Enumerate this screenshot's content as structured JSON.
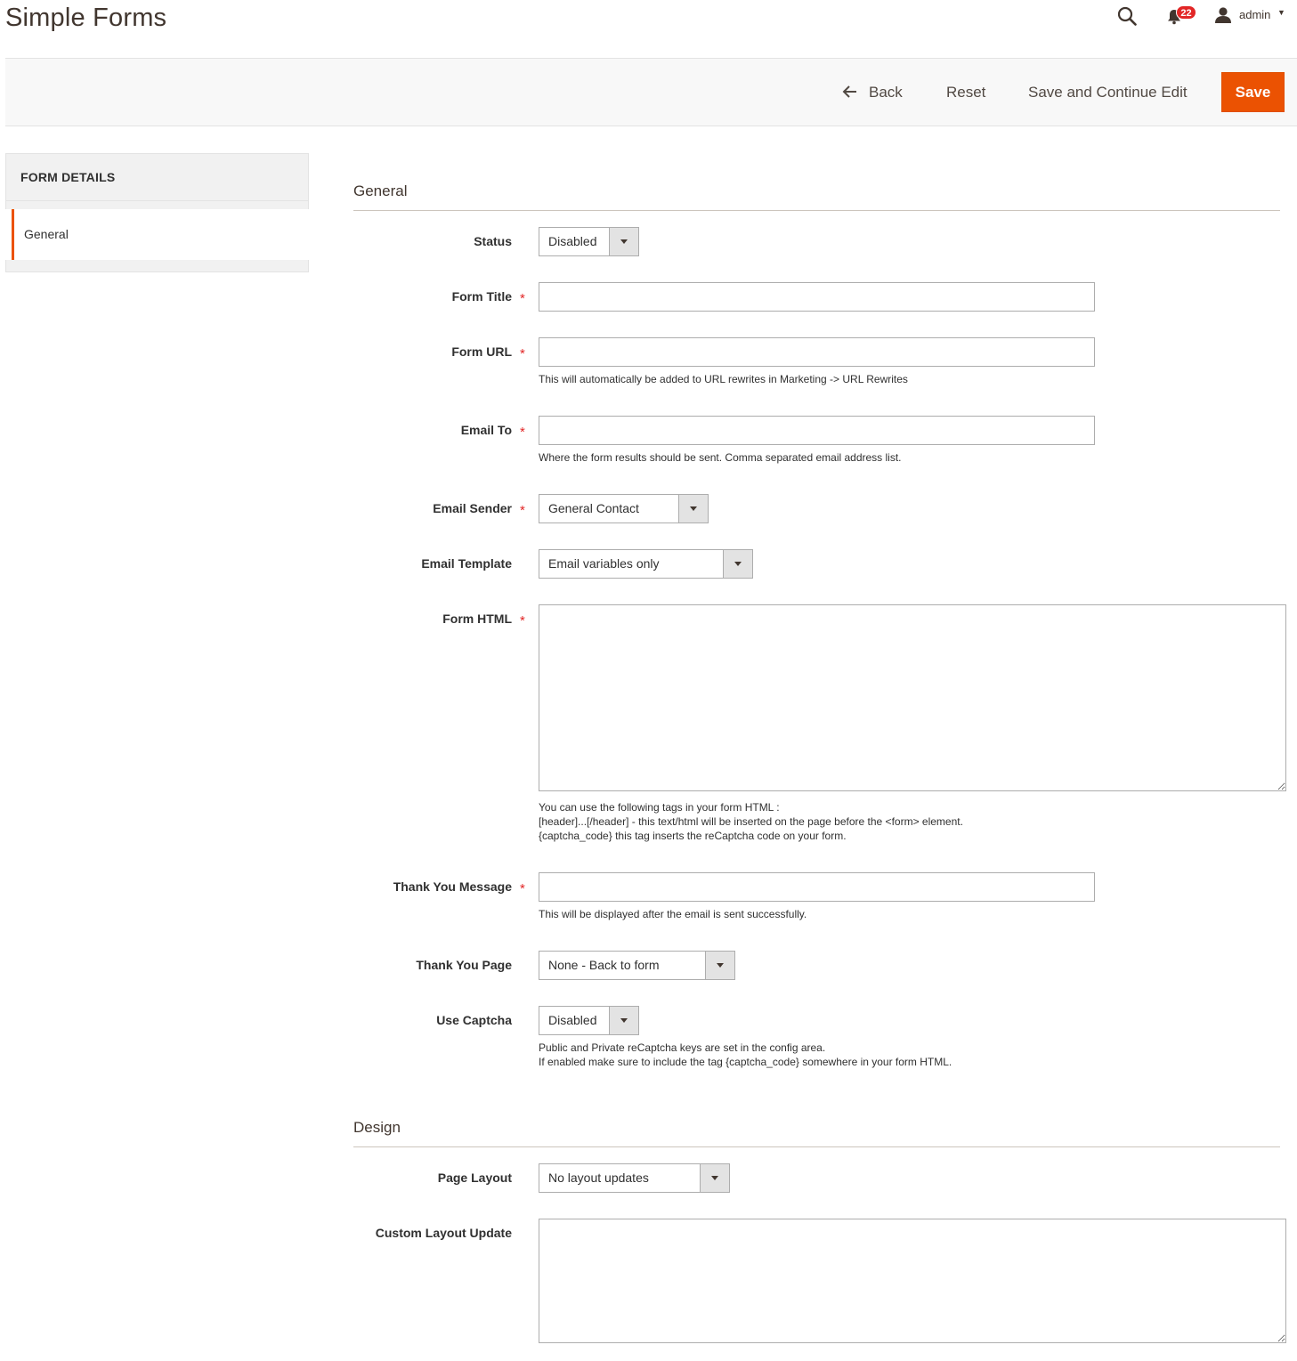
{
  "header": {
    "title": "Simple Forms",
    "notification_count": "22",
    "user_name": "admin"
  },
  "toolbar": {
    "back_label": "Back",
    "reset_label": "Reset",
    "save_continue_label": "Save and Continue Edit",
    "save_label": "Save"
  },
  "sidebar": {
    "heading": "FORM DETAILS",
    "items": [
      {
        "label": "General",
        "active": true
      }
    ]
  },
  "sections": {
    "general": "General",
    "design": "Design"
  },
  "fields": {
    "status": {
      "label": "Status",
      "value": "Disabled"
    },
    "form_title": {
      "label": "Form Title",
      "value": ""
    },
    "form_url": {
      "label": "Form URL",
      "value": "",
      "note": "This will automatically be added to URL rewrites in Marketing -> URL Rewrites"
    },
    "email_to": {
      "label": "Email To",
      "value": "",
      "note": "Where the form results should be sent. Comma separated email address list."
    },
    "email_sender": {
      "label": "Email Sender",
      "value": "General Contact"
    },
    "email_template": {
      "label": "Email Template",
      "value": "Email variables only"
    },
    "form_html": {
      "label": "Form HTML",
      "value": "",
      "note_lines": [
        "You can use the following tags in your form HTML :",
        "[header]...[/header] - this text/html will be inserted on the page before the <form> element.",
        "{captcha_code} this tag inserts the reCaptcha code on your form."
      ]
    },
    "thank_you_message": {
      "label": "Thank You Message",
      "value": "",
      "note": "This will be displayed after the email is sent successfully."
    },
    "thank_you_page": {
      "label": "Thank You Page",
      "value": "None - Back to form"
    },
    "use_captcha": {
      "label": "Use Captcha",
      "value": "Disabled",
      "note_lines": [
        "Public and Private reCaptcha keys are set in the config area.",
        "If enabled make sure to include the tag {captcha_code} somewhere in your form HTML."
      ]
    },
    "page_layout": {
      "label": "Page Layout",
      "value": "No layout updates"
    },
    "custom_layout_update": {
      "label": "Custom Layout Update",
      "value": ""
    }
  },
  "required_marker": "*",
  "colors": {
    "accent": "#eb5202",
    "badge": "#e22626",
    "toolbar_bg": "#f8f8f8"
  }
}
